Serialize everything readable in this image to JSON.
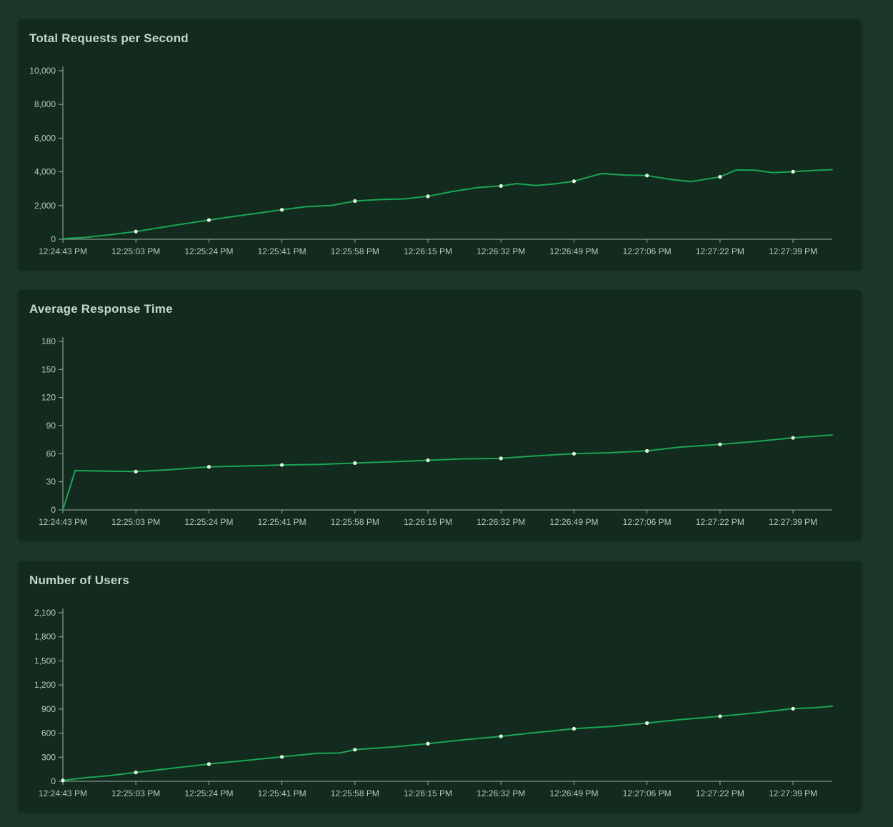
{
  "theme": {
    "page_background": "#1c3829",
    "card_background": "#132a1e",
    "title_color": "#c7d6c9",
    "tick_label_color": "#b7c8ba",
    "axis_color": "#9db1a2",
    "line_color": "#19a653",
    "dot_color": "#e8f6ec"
  },
  "chart_data": [
    {
      "type": "line",
      "title": "Total Requests per Second",
      "xlabel": "",
      "ylabel": "",
      "grid": false,
      "legend": "none",
      "ylim": [
        0,
        10000
      ],
      "x_tick_step": 0.0949,
      "x_tick_labels": [
        "12:24:43 PM",
        "12:25:03 PM",
        "12:25:24 PM",
        "12:25:41 PM",
        "12:25:58 PM",
        "12:26:15 PM",
        "12:26:32 PM",
        "12:26:49 PM",
        "12:27:06 PM",
        "12:27:22 PM",
        "12:27:39 PM"
      ],
      "y_ticks": [
        {
          "v": 0,
          "label": "0"
        },
        {
          "v": 2000,
          "label": "2,000"
        },
        {
          "v": 4000,
          "label": "4,000"
        },
        {
          "v": 6000,
          "label": "6,000"
        },
        {
          "v": 8000,
          "label": "8,000"
        },
        {
          "v": 10000,
          "label": "10,000"
        }
      ],
      "dots_from": 1,
      "series": [
        {
          "name": "Total Requests per Second",
          "points": [
            [
              0.0,
              30
            ],
            [
              0.03,
              110
            ],
            [
              0.06,
              260
            ],
            [
              0.095,
              460
            ],
            [
              0.125,
              680
            ],
            [
              0.158,
              920
            ],
            [
              0.19,
              1140
            ],
            [
              0.22,
              1340
            ],
            [
              0.255,
              1560
            ],
            [
              0.285,
              1750
            ],
            [
              0.315,
              1930
            ],
            [
              0.35,
              2010
            ],
            [
              0.38,
              2270
            ],
            [
              0.41,
              2350
            ],
            [
              0.445,
              2400
            ],
            [
              0.475,
              2550
            ],
            [
              0.505,
              2820
            ],
            [
              0.54,
              3070
            ],
            [
              0.569,
              3160
            ],
            [
              0.59,
              3300
            ],
            [
              0.615,
              3190
            ],
            [
              0.64,
              3290
            ],
            [
              0.664,
              3440
            ],
            [
              0.7,
              3900
            ],
            [
              0.73,
              3810
            ],
            [
              0.759,
              3780
            ],
            [
              0.79,
              3550
            ],
            [
              0.816,
              3420
            ],
            [
              0.854,
              3700
            ],
            [
              0.875,
              4110
            ],
            [
              0.9,
              4100
            ],
            [
              0.922,
              3950
            ],
            [
              0.949,
              4010
            ],
            [
              0.975,
              4080
            ],
            [
              1.0,
              4130
            ]
          ]
        }
      ]
    },
    {
      "type": "line",
      "title": "Average Response Time",
      "xlabel": "",
      "ylabel": "",
      "grid": false,
      "legend": "none",
      "ylim": [
        0,
        180
      ],
      "x_tick_step": 0.0949,
      "x_tick_labels": [
        "12:24:43 PM",
        "12:25:03 PM",
        "12:25:24 PM",
        "12:25:41 PM",
        "12:25:58 PM",
        "12:26:15 PM",
        "12:26:32 PM",
        "12:26:49 PM",
        "12:27:06 PM",
        "12:27:22 PM",
        "12:27:39 PM"
      ],
      "y_ticks": [
        {
          "v": 0,
          "label": "0"
        },
        {
          "v": 30,
          "label": "30"
        },
        {
          "v": 60,
          "label": "60"
        },
        {
          "v": 90,
          "label": "90"
        },
        {
          "v": 120,
          "label": "120"
        },
        {
          "v": 150,
          "label": "150"
        },
        {
          "v": 180,
          "label": "180"
        }
      ],
      "dots_from": 1,
      "series": [
        {
          "name": "Average Response Time",
          "points": [
            [
              0.0,
              0
            ],
            [
              0.016,
              42
            ],
            [
              0.05,
              41.5
            ],
            [
              0.095,
              41
            ],
            [
              0.14,
              43
            ],
            [
              0.19,
              46
            ],
            [
              0.24,
              47
            ],
            [
              0.285,
              48
            ],
            [
              0.33,
              48.5
            ],
            [
              0.38,
              50
            ],
            [
              0.43,
              51.5
            ],
            [
              0.475,
              53
            ],
            [
              0.52,
              54.5
            ],
            [
              0.569,
              55
            ],
            [
              0.61,
              57.5
            ],
            [
              0.664,
              60
            ],
            [
              0.71,
              61
            ],
            [
              0.759,
              63
            ],
            [
              0.8,
              67
            ],
            [
              0.854,
              70
            ],
            [
              0.9,
              73
            ],
            [
              0.949,
              77
            ],
            [
              1.0,
              80
            ]
          ]
        }
      ]
    },
    {
      "type": "line",
      "title": "Number of Users",
      "xlabel": "",
      "ylabel": "",
      "grid": false,
      "legend": "none",
      "ylim": [
        0,
        2100
      ],
      "x_tick_step": 0.0949,
      "x_tick_labels": [
        "12:24:43 PM",
        "12:25:03 PM",
        "12:25:24 PM",
        "12:25:41 PM",
        "12:25:58 PM",
        "12:26:15 PM",
        "12:26:32 PM",
        "12:26:49 PM",
        "12:27:06 PM",
        "12:27:22 PM",
        "12:27:39 PM"
      ],
      "y_ticks": [
        {
          "v": 0,
          "label": "0"
        },
        {
          "v": 300,
          "label": "300"
        },
        {
          "v": 600,
          "label": "600"
        },
        {
          "v": 900,
          "label": "900"
        },
        {
          "v": 1200,
          "label": "1,200"
        },
        {
          "v": 1500,
          "label": "1,500"
        },
        {
          "v": 1800,
          "label": "1,800"
        },
        {
          "v": 2100,
          "label": "2,100"
        }
      ],
      "dots_from": 0,
      "series": [
        {
          "name": "Number of Users",
          "points": [
            [
              0.0,
              10
            ],
            [
              0.03,
              45
            ],
            [
              0.06,
              70
            ],
            [
              0.095,
              110
            ],
            [
              0.14,
              160
            ],
            [
              0.19,
              215
            ],
            [
              0.24,
              262
            ],
            [
              0.285,
              305
            ],
            [
              0.33,
              348
            ],
            [
              0.36,
              352
            ],
            [
              0.38,
              395
            ],
            [
              0.43,
              428
            ],
            [
              0.475,
              470
            ],
            [
              0.52,
              516
            ],
            [
              0.569,
              560
            ],
            [
              0.61,
              602
            ],
            [
              0.664,
              655
            ],
            [
              0.71,
              682
            ],
            [
              0.759,
              725
            ],
            [
              0.8,
              766
            ],
            [
              0.854,
              810
            ],
            [
              0.9,
              852
            ],
            [
              0.949,
              905
            ],
            [
              0.975,
              916
            ],
            [
              1.0,
              935
            ]
          ]
        }
      ]
    }
  ]
}
